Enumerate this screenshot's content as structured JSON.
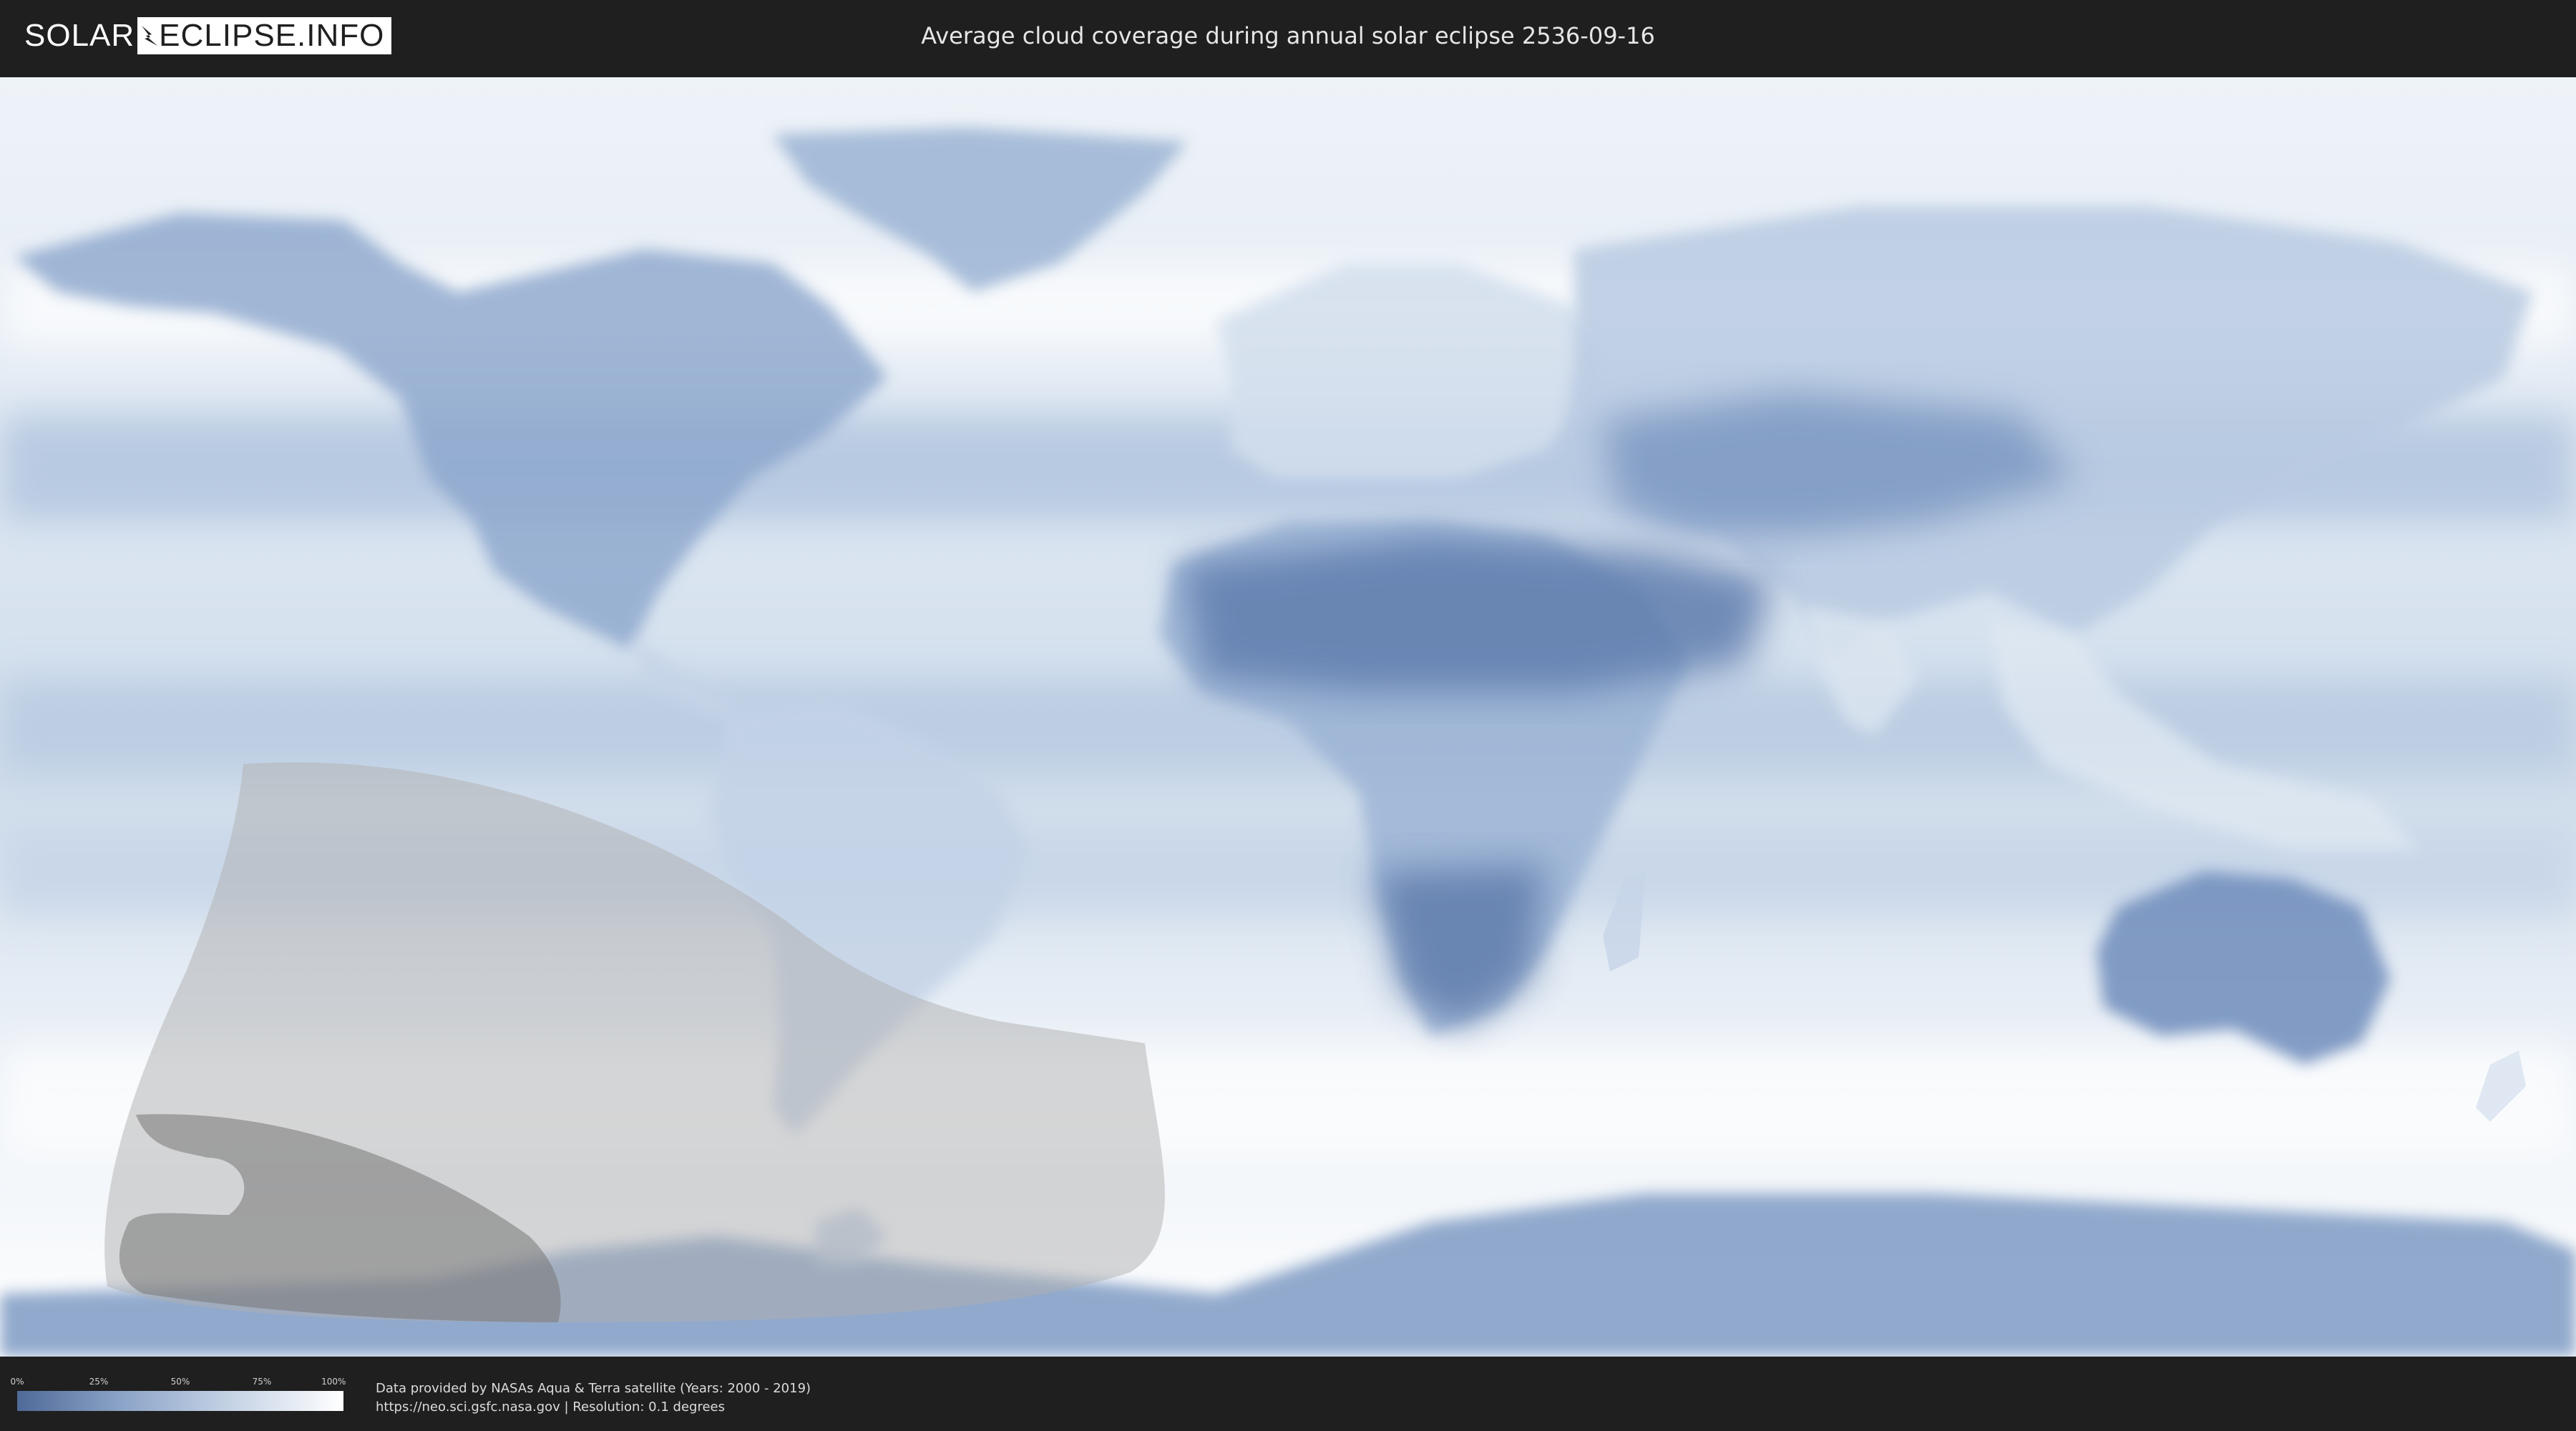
{
  "header": {
    "logo_left": "SOLAR",
    "logo_right": "ECLIPSE.INFO",
    "title": "Average cloud coverage during annual solar eclipse 2536-09-16"
  },
  "legend": {
    "ticks": [
      "0%",
      "25%",
      "50%",
      "75%",
      "100%"
    ],
    "gradient": [
      "#4f6a98",
      "#8ea6c9",
      "#c7d4e6",
      "#ffffff"
    ]
  },
  "credits": {
    "line1": "Data provided by NASAs Aqua & Terra satellite (Years: 2000 - 2019)",
    "line2": "https://neo.sci.gsfc.nasa.gov | Resolution: 0.1 degrees"
  },
  "colors": {
    "background": "#1f1f1f",
    "cloud": "#f2f6fa",
    "clear_sky": "#5a78a8",
    "eclipse_partial": "#b3b3b3",
    "eclipse_path": "#7a7a7a"
  }
}
